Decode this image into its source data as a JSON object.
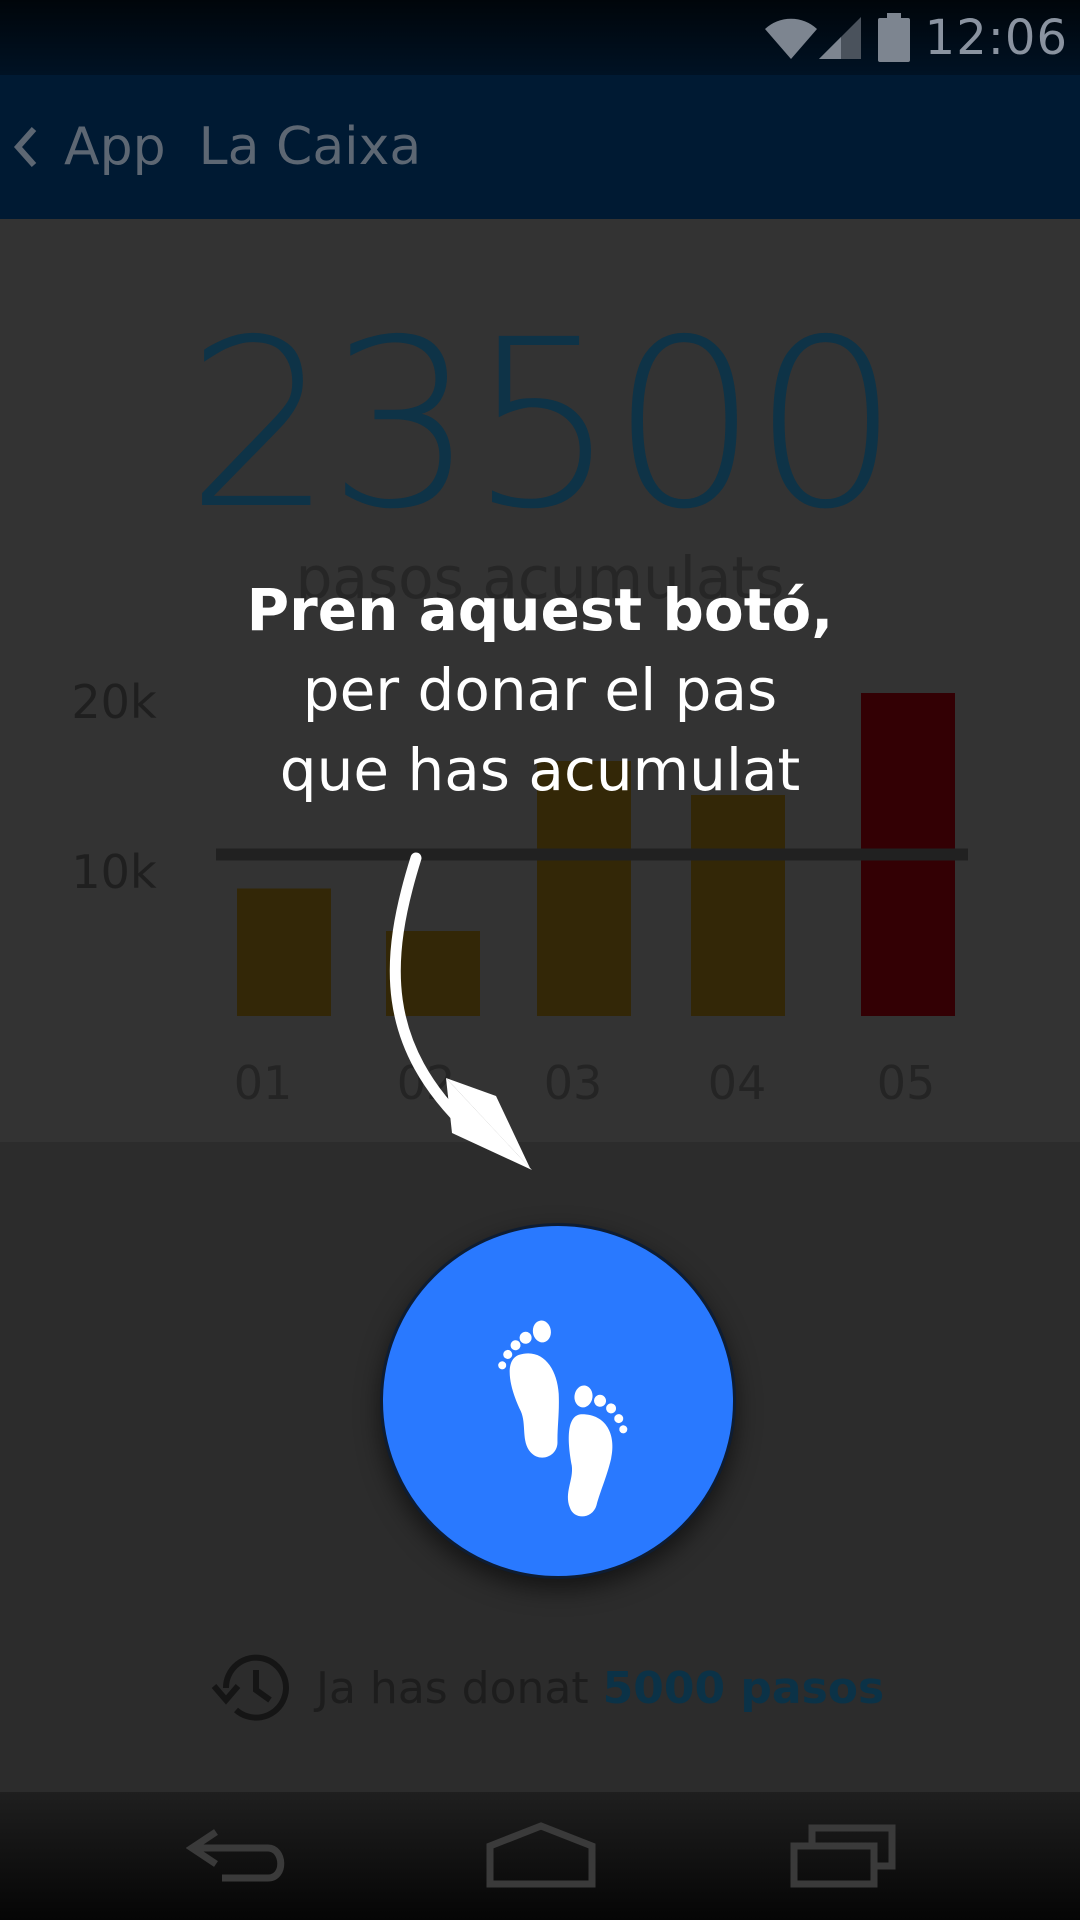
{
  "status_bar": {
    "time": "12:06",
    "icons": [
      "wifi-icon",
      "signal-icon",
      "battery-icon"
    ]
  },
  "app_bar": {
    "title": "App  La Caixa",
    "back_icon": "chevron-left-icon"
  },
  "summary": {
    "total": "23500",
    "caption": "pasos acumulats"
  },
  "chart_data": {
    "type": "bar",
    "categories": [
      "01",
      "02",
      "03",
      "04",
      "05"
    ],
    "values": [
      7500,
      5000,
      15000,
      13000,
      19000
    ],
    "y_ticks": [
      "20k",
      "10k"
    ],
    "reference_line": 9500,
    "ylim": [
      0,
      22000
    ],
    "colors": [
      "#332707",
      "#332707",
      "#332707",
      "#332707",
      "#330004"
    ]
  },
  "tutorial": {
    "line1": "Pren aquest botó,",
    "line2": "per donar el pas",
    "line3": "que has acumulat"
  },
  "fab": {
    "icon": "footprints-icon",
    "color": "#2979ff"
  },
  "donated": {
    "icon": "history-icon",
    "prefix": "Ja has donat",
    "amount": "5000 pasos"
  },
  "nav_bar": {
    "icons": [
      "back-icon",
      "home-icon",
      "recents-icon"
    ]
  }
}
